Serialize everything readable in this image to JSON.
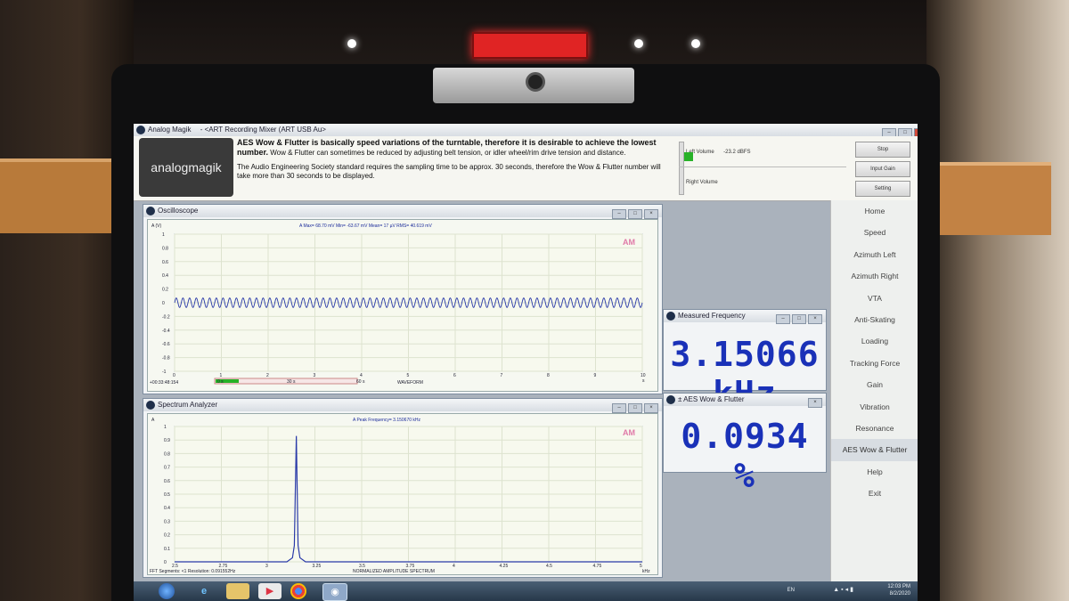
{
  "app": {
    "title": "Analog Magik",
    "subtitle": "- <ART Recording Mixer (ART USB Au>"
  },
  "header": {
    "logo_text": "analogmagik",
    "heading": "AES Wow & Flutter is basically speed variations of the turntable, therefore it is desirable to achieve the lowest number.",
    "body1": "Wow & Flutter can sometimes be reduced by adjusting belt tension, or idler wheel/rim drive tension and distance.",
    "body2": "The Audio Engineering Society standard requires the sampling time to be approx. 30 seconds, therefore the Wow & Flutter number will take more than 30 seconds to be displayed.",
    "left_volume_label": "Left Volume",
    "left_volume_value": "-23.2 dBFS",
    "right_volume_label": "Right Volume",
    "buttons": [
      "Stop",
      "Input Gain",
      "Setting"
    ]
  },
  "oscilloscope": {
    "title": "Oscilloscope",
    "yaxis_unit": "A (V)",
    "stats": "A  Max=     68.70  mV  Min=     -63.67  mV  Mean=          17  µV  RMS=     40.619  mV",
    "channel": "AM",
    "timestamp": "+00:33:48:154",
    "xlabel": "WAVEFORM",
    "x_unit": "s",
    "progress_labels": [
      "0 s",
      "30 s",
      "60 s"
    ]
  },
  "spectrum": {
    "title": "Spectrum Analyzer",
    "yaxis_unit": "A",
    "stats": "A  Peak Frequency=   3.150670  kHz",
    "channel": "AM",
    "xlabel": "NORMALIZED AMPLITUDE SPECTRUM",
    "x_unit": "kHz",
    "footer": "FFT  Segments: <1      Resolution:  0.091552Hz"
  },
  "measured_frequency": {
    "title": "Measured Frequency",
    "value": "3.15066 kHz"
  },
  "wow_flutter": {
    "title": "± AES Wow & Flutter",
    "value": "0.0934 %"
  },
  "menu": {
    "items": [
      "Home",
      "Speed",
      "Azimuth Left",
      "Azimuth Right",
      "VTA",
      "Anti-Skating",
      "Loading",
      "Tracking Force",
      "Gain",
      "Vibration",
      "Resonance",
      "AES Wow & Flutter",
      "Help",
      "Exit"
    ],
    "active": "AES Wow & Flutter"
  },
  "taskbar": {
    "language": "EN",
    "time": "12:03 PM",
    "date": "8/2/2020"
  },
  "colors": {
    "readout": "#1a31b8",
    "trace": "#2a3aa8",
    "channel_label": "#e07aa8",
    "volume_meter": "#28b228"
  },
  "chart_data": [
    {
      "type": "line",
      "title": "Oscilloscope",
      "ylabel": "A (V)",
      "xlabel": "WAVEFORM",
      "x_unit": "s",
      "xlim": [
        0,
        10
      ],
      "ylim": [
        -1,
        1
      ],
      "x_ticks": [
        0,
        1,
        2,
        3,
        4,
        5,
        6,
        7,
        8,
        9,
        10
      ],
      "y_ticks": [
        "1",
        "0.8",
        "0.6",
        "0.4",
        "0.2",
        "0",
        "-0.2",
        "-0.4",
        "-0.6",
        "-0.8",
        "-1"
      ],
      "series": [
        {
          "amplitude": 0.0687,
          "offset": 0,
          "cycles_displayed": 70
        }
      ]
    },
    {
      "type": "line",
      "title": "Spectrum Analyzer",
      "xlabel": "NORMALIZED AMPLITUDE SPECTRUM",
      "x_unit": "kHz",
      "xlim": [
        2.5,
        5
      ],
      "ylim": [
        0,
        1
      ],
      "x_ticks": [
        "2.5",
        "2.75",
        "3",
        "3.25",
        "3.5",
        "3.75",
        "4",
        "4.25",
        "4.5",
        "4.75",
        "5"
      ],
      "y_ticks": [
        "1",
        "0.9",
        "0.8",
        "0.7",
        "0.6",
        "0.5",
        "0.4",
        "0.3",
        "0.2",
        "0.1",
        "0"
      ],
      "series": [
        {
          "x": [
            2.5,
            3.1,
            3.13,
            3.14,
            3.1507,
            3.16,
            3.17,
            3.2,
            5.0
          ],
          "y": [
            0,
            0.0,
            0.03,
            0.12,
            0.93,
            0.12,
            0.03,
            0.0,
            0
          ]
        }
      ]
    }
  ]
}
